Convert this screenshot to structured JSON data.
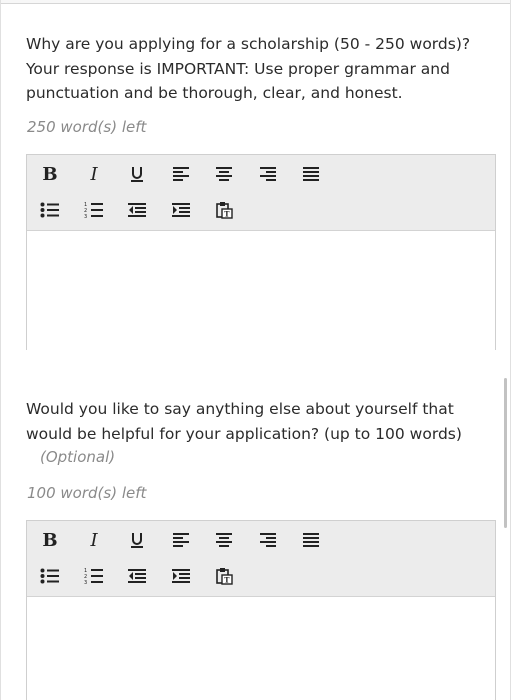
{
  "questions": [
    {
      "prompt": "Why are you applying for a scholarship (50 - 250 words)? Your response is IMPORTANT: Use proper grammar and punctuation and be thorough, clear, and honest.",
      "counter": "250 word(s) left"
    },
    {
      "prompt": "Would you like to say anything else about yourself that would be helpful for your application? (up to 100 words)",
      "optional": "(Optional)",
      "counter": "100 word(s) left"
    }
  ],
  "toolbar": {
    "bold": "B",
    "italic": "I",
    "underline": "U",
    "icons": [
      "bold-icon",
      "italic-icon",
      "underline-icon",
      "align-left-icon",
      "align-center-icon",
      "align-right-icon",
      "align-justify-icon",
      "bulleted-list-icon",
      "numbered-list-icon",
      "outdent-icon",
      "indent-icon",
      "paste-text-icon"
    ]
  }
}
